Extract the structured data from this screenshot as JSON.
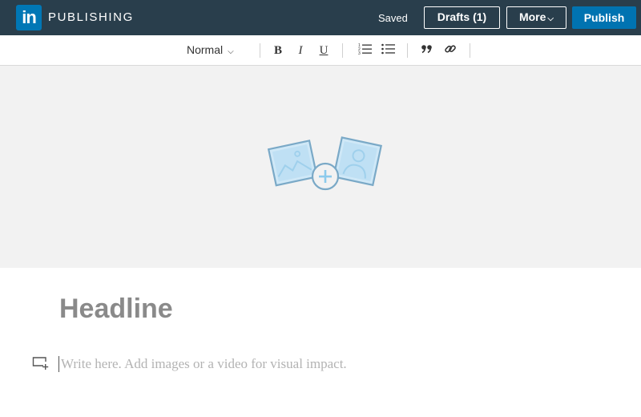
{
  "topbar": {
    "logo_text": "in",
    "brand": "PUBLISHING",
    "status": "Saved",
    "drafts_label": "Drafts (1)",
    "more_label": "More",
    "publish_label": "Publish"
  },
  "toolbar": {
    "style_select_value": "Normal",
    "buttons": [
      "bold-icon",
      "italic-icon",
      "underline-icon",
      "numbered-list-icon",
      "bulleted-list-icon",
      "quote-icon",
      "link-icon"
    ],
    "bold": "B",
    "italic": "I",
    "underline": "U"
  },
  "editor": {
    "headline_placeholder": "Headline",
    "body_placeholder": "Write here. Add images or a video for visual impact."
  },
  "colors": {
    "topbar_bg": "#293e4c",
    "brand_blue": "#0077b5",
    "publish_bg": "#0073b1",
    "cover_bg": "#f2f2f2",
    "placeholder": "#b3b3b3"
  }
}
